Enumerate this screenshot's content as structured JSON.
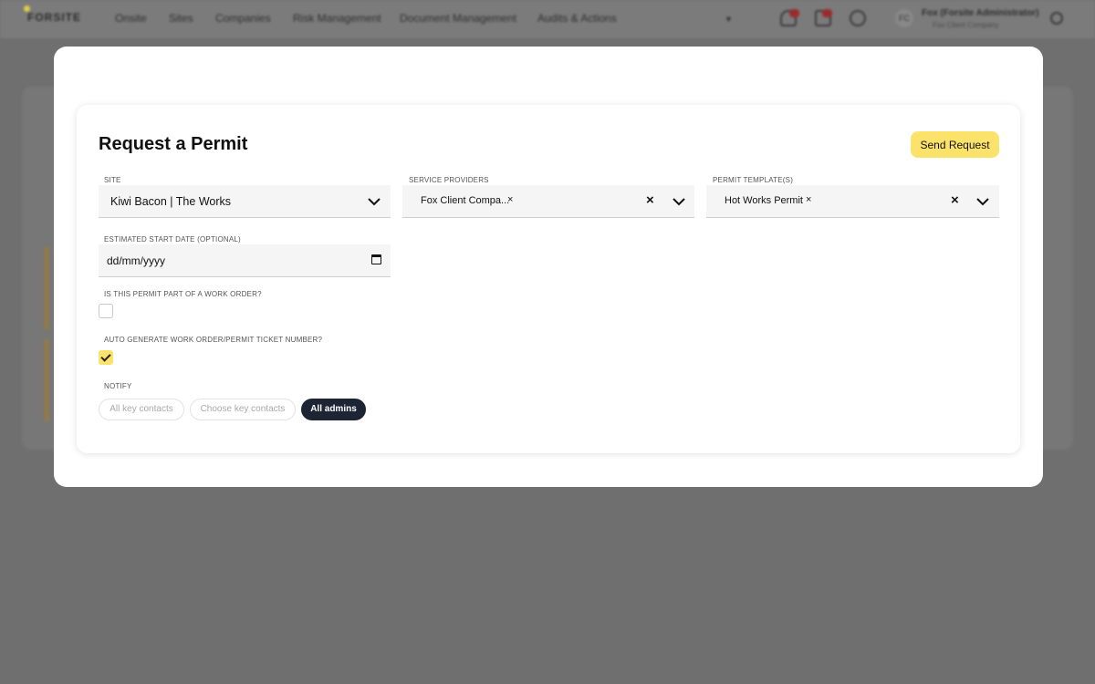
{
  "topbar": {
    "logo": "FORSITE",
    "nav": [
      "Onsite",
      "Sites",
      "Companies",
      "Risk Management",
      "Document Management",
      "Audits & Actions"
    ],
    "user_initials": "FC",
    "user_name": "Fox (Forsite Administrator)",
    "user_company": "Fox Client Company",
    "notification_count": "1",
    "tasks_count": "1"
  },
  "modal": {
    "title": "Request a Permit",
    "send_label": "Send Request",
    "site": {
      "label": "SITE",
      "value": "Kiwi Bacon | The Works"
    },
    "service_providers": {
      "label": "SERVICE PROVIDERS",
      "chip": "Fox Client Compa...",
      "chip_remove": "×",
      "clear": "×"
    },
    "permit_templates": {
      "label": "PERMIT TEMPLATE(S)",
      "chip": "Hot Works Permit",
      "chip_remove": "×",
      "clear": "×"
    },
    "start_date": {
      "label": "ESTIMATED START DATE (OPTIONAL)",
      "placeholder": "dd/mm/yyyy"
    },
    "work_order": {
      "label": "IS THIS PERMIT PART OF A WORK ORDER?",
      "checked": false
    },
    "auto_generate": {
      "label": "AUTO GENERATE WORK ORDER/PERMIT TICKET NUMBER?",
      "checked": true
    },
    "notify": {
      "label": "NOTIFY",
      "options": [
        "All key contacts",
        "Choose key contacts",
        "All admins"
      ],
      "selected": "All admins"
    }
  },
  "colors": {
    "accent": "#fbe36b",
    "selected_pill": "#1d2433",
    "overlay": "#6f6f6f"
  }
}
